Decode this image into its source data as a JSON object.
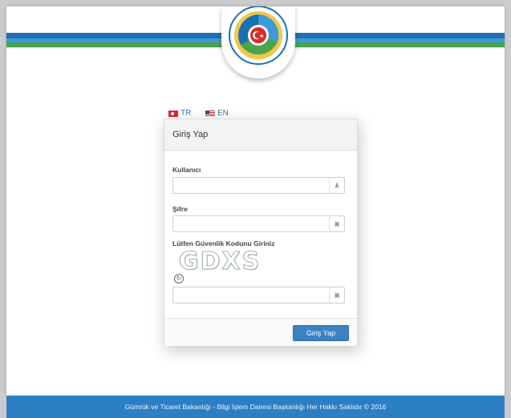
{
  "header": {
    "emblem_name": "ministry-emblem-icon"
  },
  "languages": [
    {
      "code": "TR",
      "flag": "turkey-flag-icon"
    },
    {
      "code": "EN",
      "flag": "usa-flag-icon"
    }
  ],
  "login": {
    "title": "Giriş Yap",
    "username": {
      "label": "Kullanıcı",
      "value": "",
      "icon": "user-icon"
    },
    "password": {
      "label": "Şifre",
      "value": "",
      "icon": "lock-icon"
    },
    "captcha": {
      "label": "Lütfen Güvenlik Kodunu Giriniz",
      "code": "GDXS",
      "refresh_icon": "refresh-icon",
      "value": "",
      "icon": "lock-icon"
    },
    "submit_label": "Giriş Yap"
  },
  "footer": {
    "text": "Gümrük ve Ticaret Bakanlığı - Bilgi İşlem Dairesi Başkanlığı Her Hakkı Saklıdır © 2016"
  },
  "colors": {
    "brand_blue": "#1b6fb3",
    "brand_green": "#4aa34e",
    "button": "#3a82c4",
    "footer": "#2d7fc4"
  }
}
